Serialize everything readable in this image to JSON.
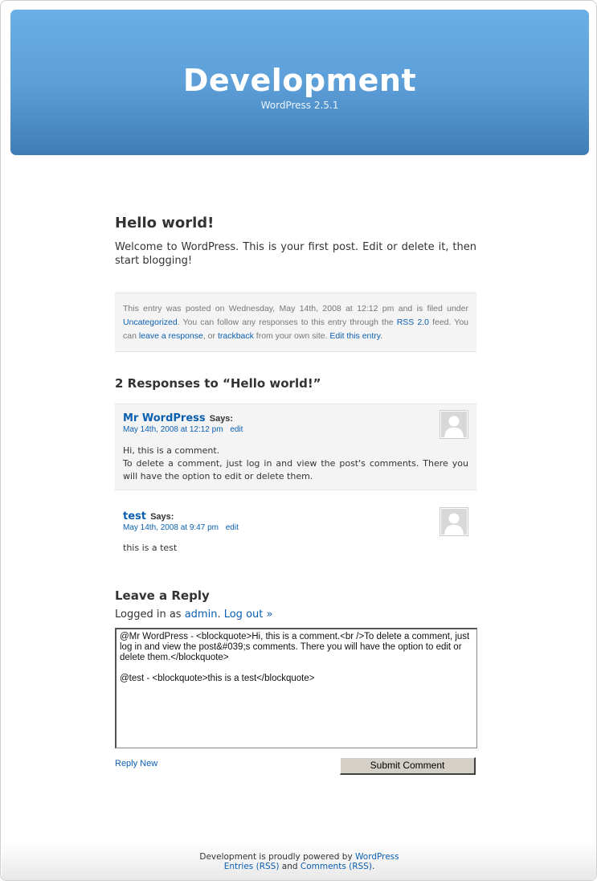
{
  "blog": {
    "title": "Development",
    "description": "WordPress 2.5.1"
  },
  "post": {
    "title": "Hello world!",
    "body": "Welcome to WordPress. This is your first post. Edit or delete it, then start blogging!",
    "meta": {
      "prefix": "This entry was posted on Wednesday, May 14th, 2008 at 12:12 pm and is filed under",
      "category": "Uncategorized",
      "mid1": ". You can follow any responses to this entry through the",
      "rss_link": "RSS 2.0",
      "mid2": "feed. You can",
      "leave_response": "leave a response",
      "mid3": ", or",
      "trackback": "trackback",
      "mid4": "from your own site.",
      "edit_entry": "Edit this entry",
      "end": "."
    }
  },
  "comments": {
    "title": "2 Responses to “Hello world!”",
    "says": "Says:",
    "items": [
      {
        "author": "Mr WordPress",
        "date": "May 14th, 2008 at 12:12 pm",
        "edit": "edit",
        "line1": "Hi, this is a comment.",
        "line2": "To delete a comment, just log in and view the post's comments. There you will have the option to edit or delete them."
      },
      {
        "author": "test",
        "date": "May 14th, 2008 at 9:47 pm",
        "edit": "edit",
        "line1": "this is a test"
      }
    ]
  },
  "reply": {
    "title": "Leave a Reply",
    "logged_in_prefix": "Logged in as",
    "user": "admin",
    "logout": "Log out »",
    "textarea": "@Mr WordPress - <blockquote>Hi, this is a comment.<br />To delete a comment, just log in and view the post&#039;s comments. There you will have the option to edit or delete them.</blockquote>\n\n@test - <blockquote>this is a test</blockquote>",
    "reply_new": "Reply New",
    "submit": "Submit Comment"
  },
  "footer": {
    "line1_prefix": "Development is proudly powered by",
    "wordpress": "WordPress",
    "entries_rss": "Entries (RSS)",
    "and": "and",
    "comments_rss": "Comments (RSS)",
    "end": "."
  }
}
